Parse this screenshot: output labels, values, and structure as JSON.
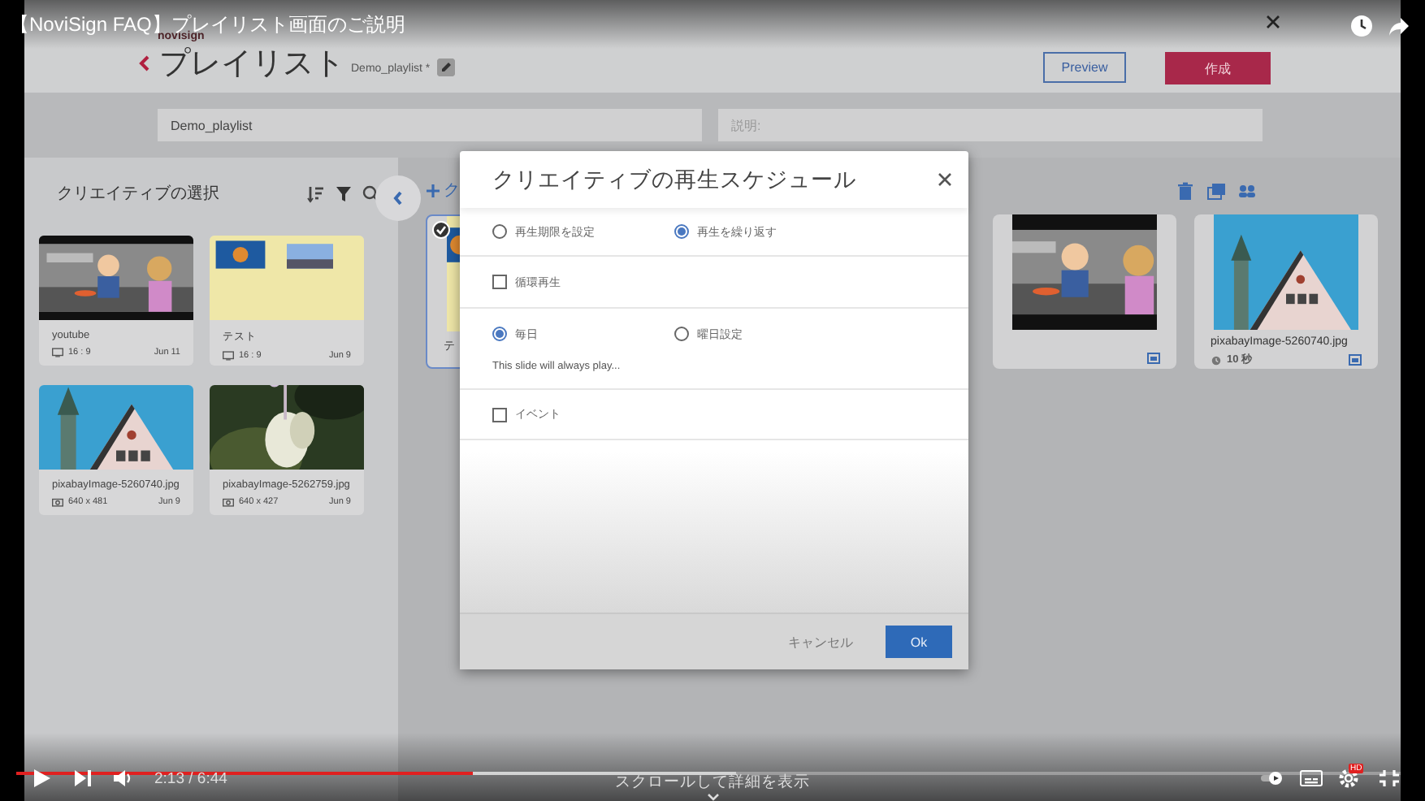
{
  "video": {
    "title": "【NoviSign FAQ】プレイリスト画面のご説明",
    "time": "2:13 / 6:44",
    "scroll_hint": "スクロールして詳細を表示",
    "hd_badge": "HD",
    "progress": {
      "level": 0.33
    },
    "buffered": {
      "level": 0.52
    }
  },
  "header": {
    "logo": "novisign",
    "title": "プレイリスト",
    "playlist_name": "Demo_playlist *",
    "preview_button": "Preview",
    "create_button": "作成"
  },
  "fields": {
    "name": {
      "value": "Demo_playlist"
    },
    "description": {
      "placeholder": "説明:"
    }
  },
  "library": {
    "title": "クリエイティブの選択",
    "items": [
      {
        "name": "youtube",
        "kind": "video",
        "info": "16 : 9",
        "date": "Jun 11"
      },
      {
        "name": "テスト",
        "kind": "video",
        "info": "16 : 9",
        "date": "Jun 9"
      },
      {
        "name": "pixabayImage-5260740.jpg",
        "info": "640 x 481",
        "date": "Jun 9"
      },
      {
        "name": "pixabayImage-5262759.jpg",
        "info": "640 x 427",
        "date": "Jun 9"
      }
    ]
  },
  "playlist": {
    "add_label": "ク",
    "items": [
      {
        "name": "テ",
        "selected": true
      },
      {
        "selected": false
      },
      {
        "name": "pixabayImage-5260740.jpg",
        "duration": "10 秒",
        "selected": false
      }
    ]
  },
  "dialog": {
    "title": "クリエイティブの再生スケジュール",
    "mode_options": [
      {
        "label": "再生期限を設定",
        "selected": false
      },
      {
        "label": "再生を繰り返す",
        "selected": true
      }
    ],
    "loop": {
      "label": "循環再生",
      "checked": false
    },
    "day_options": [
      {
        "label": "毎日",
        "selected": true
      },
      {
        "label": "曜日設定",
        "selected": false
      }
    ],
    "note": "This slide will always play...",
    "event": {
      "label": "イベント",
      "checked": false
    },
    "cancel_button": "キャンセル",
    "ok_button": "Ok"
  }
}
